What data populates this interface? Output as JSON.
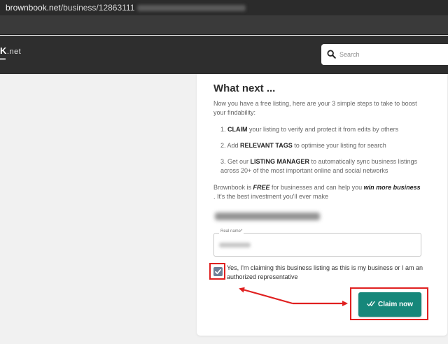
{
  "browser": {
    "url_host": "brownbook.net",
    "url_path": "/business/12863111"
  },
  "header": {
    "logo_text": "K",
    "logo_tld": ".net",
    "search_placeholder": "Search"
  },
  "card": {
    "title": "What next ...",
    "intro": "Now you have a free listing, here are your 3 simple steps to take to boost your findability:",
    "steps": [
      {
        "pre": "1. ",
        "bold": "CLAIM",
        "post": " your listing to verify and protect it from edits by others"
      },
      {
        "pre": "2. Add ",
        "bold": "RELEVANT TAGS",
        "post": " to optimise your listing for search"
      },
      {
        "pre": "3. Get our ",
        "bold": "LISTING MANAGER",
        "post": " to automatically sync business listings across 20+ of the most important online and social networks"
      }
    ],
    "free_note": {
      "pre": "Brownbook is ",
      "bold1": "FREE",
      "mid": " for businesses and can help you ",
      "bold2": "win more business",
      "post": " . It's the best investment you'll ever make"
    },
    "real_name_label": "Real name*",
    "confirm_text": "Yes, I'm claiming this business listing as this is my business or I am an authorized representative",
    "claim_button": "Claim now"
  },
  "colors": {
    "accent": "#16877a",
    "annotation": "#e02020",
    "checkbox": "#6f7f97"
  }
}
